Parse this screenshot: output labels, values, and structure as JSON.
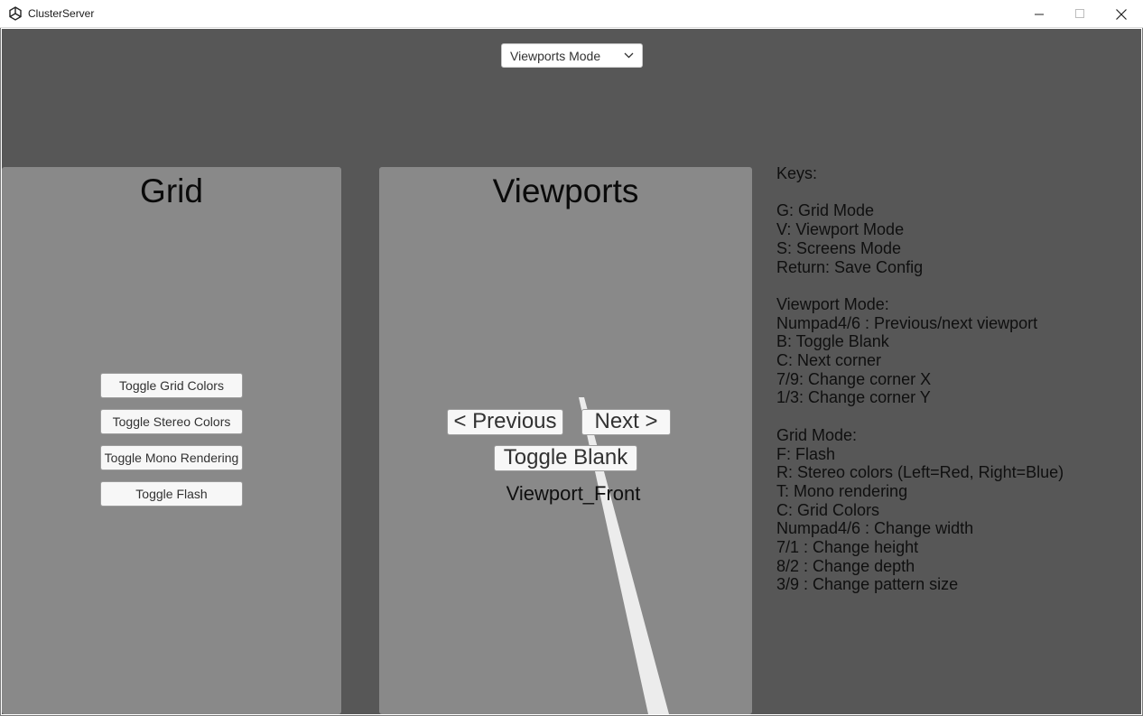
{
  "window": {
    "title": "ClusterServer",
    "icon": "unity-icon",
    "controls": [
      "minimize-icon",
      "maximize-icon",
      "close-icon"
    ]
  },
  "mode_dropdown": {
    "selected": "Viewports Mode",
    "icon": "chevron-down-icon"
  },
  "grid_panel": {
    "title": "Grid",
    "buttons": [
      "Toggle Grid Colors",
      "Toggle Stereo Colors",
      "Toggle Mono Rendering",
      "Toggle Flash"
    ]
  },
  "viewports_panel": {
    "title": "Viewports",
    "previous_label": "< Previous",
    "next_label": "Next >",
    "toggle_blank_label": "Toggle Blank",
    "current_viewport": "Viewport_Front"
  },
  "keys_help": {
    "lines": [
      "Keys:",
      "",
      "G: Grid Mode",
      "V: Viewport Mode",
      "S: Screens Mode",
      "Return: Save Config",
      "",
      "Viewport Mode:",
      "Numpad4/6 : Previous/next viewport",
      "B: Toggle Blank",
      "C: Next corner",
      "7/9: Change corner X",
      "1/3: Change corner Y",
      "",
      "Grid Mode:",
      "F: Flash",
      "R: Stereo colors (Left=Red, Right=Blue)",
      "T: Mono rendering",
      "C: Grid Colors",
      "Numpad4/6 : Change width",
      "7/1 : Change height",
      "8/2 : Change depth",
      "3/9 : Change pattern size"
    ]
  },
  "colors": {
    "background": "#575757",
    "panel": "#898989",
    "button": "#f7f7f7",
    "text": "#0f0f0f"
  }
}
